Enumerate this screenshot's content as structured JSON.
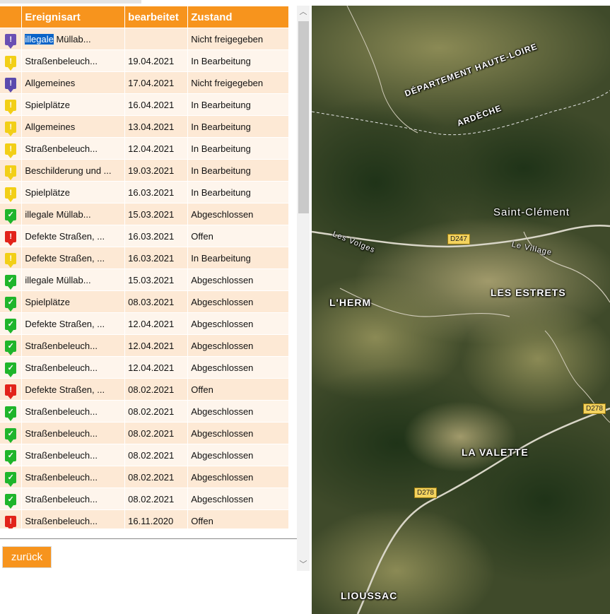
{
  "table": {
    "headers": [
      "",
      "Ereignisart",
      "bearbeitet",
      "Zustand"
    ],
    "rows": [
      {
        "icon": "purple-pin-icon",
        "color": "#6a4fb3",
        "type_sel": "illegale",
        "type": " Müllab...",
        "date": "",
        "status": "Nicht freigegeben"
      },
      {
        "icon": "yellow-pin-icon",
        "color": "#f2cf17",
        "type": "Straßenbeleuch...",
        "date": "19.04.2021",
        "status": "In Bearbeitung"
      },
      {
        "icon": "purple-pin-icon",
        "color": "#5b4aad",
        "type": "Allgemeines",
        "date": "17.04.2021",
        "status": "Nicht freigegeben"
      },
      {
        "icon": "yellow-pin-icon",
        "color": "#f2cf17",
        "type": "Spielplätze",
        "date": "16.04.2021",
        "status": "In Bearbeitung"
      },
      {
        "icon": "yellow-pin-icon",
        "color": "#f2cf17",
        "type": "Allgemeines",
        "date": "13.04.2021",
        "status": "In Bearbeitung"
      },
      {
        "icon": "yellow-pin-icon",
        "color": "#f2cf17",
        "type": "Straßenbeleuch...",
        "date": "12.04.2021",
        "status": "In Bearbeitung"
      },
      {
        "icon": "yellow-pin-icon",
        "color": "#f2cf17",
        "type": "Beschilderung und ...",
        "date": "19.03.2021",
        "status": "In Bearbeitung"
      },
      {
        "icon": "yellow-pin-icon",
        "color": "#f2cf17",
        "type": "Spielplätze",
        "date": "16.03.2021",
        "status": "In Bearbeitung"
      },
      {
        "icon": "green-pin-icon",
        "color": "#1fb52b",
        "type": "illegale Müllab...",
        "date": "15.03.2021",
        "status": "Abgeschlossen"
      },
      {
        "icon": "red-pin-icon",
        "color": "#e2231a",
        "type": "Defekte Straßen, ...",
        "date": "16.03.2021",
        "status": "Offen"
      },
      {
        "icon": "yellow-pin-icon",
        "color": "#f2cf17",
        "type": "Defekte Straßen, ...",
        "date": "16.03.2021",
        "status": "In Bearbeitung"
      },
      {
        "icon": "green-pin-icon",
        "color": "#1fb52b",
        "type": "illegale Müllab...",
        "date": "15.03.2021",
        "status": "Abgeschlossen"
      },
      {
        "icon": "green-pin-icon",
        "color": "#1fb52b",
        "type": "Spielplätze",
        "date": "08.03.2021",
        "status": "Abgeschlossen"
      },
      {
        "icon": "green-pin-icon",
        "color": "#1fb52b",
        "type": "Defekte Straßen, ...",
        "date": "12.04.2021",
        "status": "Abgeschlossen"
      },
      {
        "icon": "green-pin-icon",
        "color": "#1fb52b",
        "type": "Straßenbeleuch...",
        "date": "12.04.2021",
        "status": "Abgeschlossen"
      },
      {
        "icon": "green-pin-icon",
        "color": "#1fb52b",
        "type": "Straßenbeleuch...",
        "date": "12.04.2021",
        "status": "Abgeschlossen"
      },
      {
        "icon": "red-pin-icon",
        "color": "#e2231a",
        "type": "Defekte Straßen, ...",
        "date": "08.02.2021",
        "status": "Offen"
      },
      {
        "icon": "green-pin-icon",
        "color": "#1fb52b",
        "type": "Straßenbeleuch...",
        "date": "08.02.2021",
        "status": "Abgeschlossen"
      },
      {
        "icon": "green-pin-icon",
        "color": "#1fb52b",
        "type": "Straßenbeleuch...",
        "date": "08.02.2021",
        "status": "Abgeschlossen"
      },
      {
        "icon": "green-pin-icon",
        "color": "#1fb52b",
        "type": "Straßenbeleuch...",
        "date": "08.02.2021",
        "status": "Abgeschlossen"
      },
      {
        "icon": "green-pin-icon",
        "color": "#1fb52b",
        "type": "Straßenbeleuch...",
        "date": "08.02.2021",
        "status": "Abgeschlossen"
      },
      {
        "icon": "green-pin-icon",
        "color": "#1fb52b",
        "type": "Straßenbeleuch...",
        "date": "08.02.2021",
        "status": "Abgeschlossen"
      },
      {
        "icon": "red-pin-icon",
        "color": "#e2231a",
        "type": "Straßenbeleuch...",
        "date": "16.11.2020",
        "status": "Offen"
      }
    ]
  },
  "back_button": {
    "label": "zurück"
  },
  "map": {
    "labels": {
      "dept_haute_loire": "DÉPARTEMENT HAUTE-LOIRE",
      "ardeche": "ARDÈCHE",
      "saint_clement": "Saint-Clément",
      "les_volges": "Les Volges",
      "le_village": "Le Village",
      "les_estrets": "LES ESTRETS",
      "lherm": "L'HERM",
      "la_valette": "LA VALETTE",
      "lioussac": "LIOUSSAC"
    },
    "roads": {
      "d247": "D247",
      "d278_a": "D278",
      "d278_b": "D278"
    }
  },
  "colors": {
    "accent": "#f7941d",
    "row_odd": "#fde9d5",
    "row_even": "#fef5ec",
    "selection": "#0a64c8"
  }
}
